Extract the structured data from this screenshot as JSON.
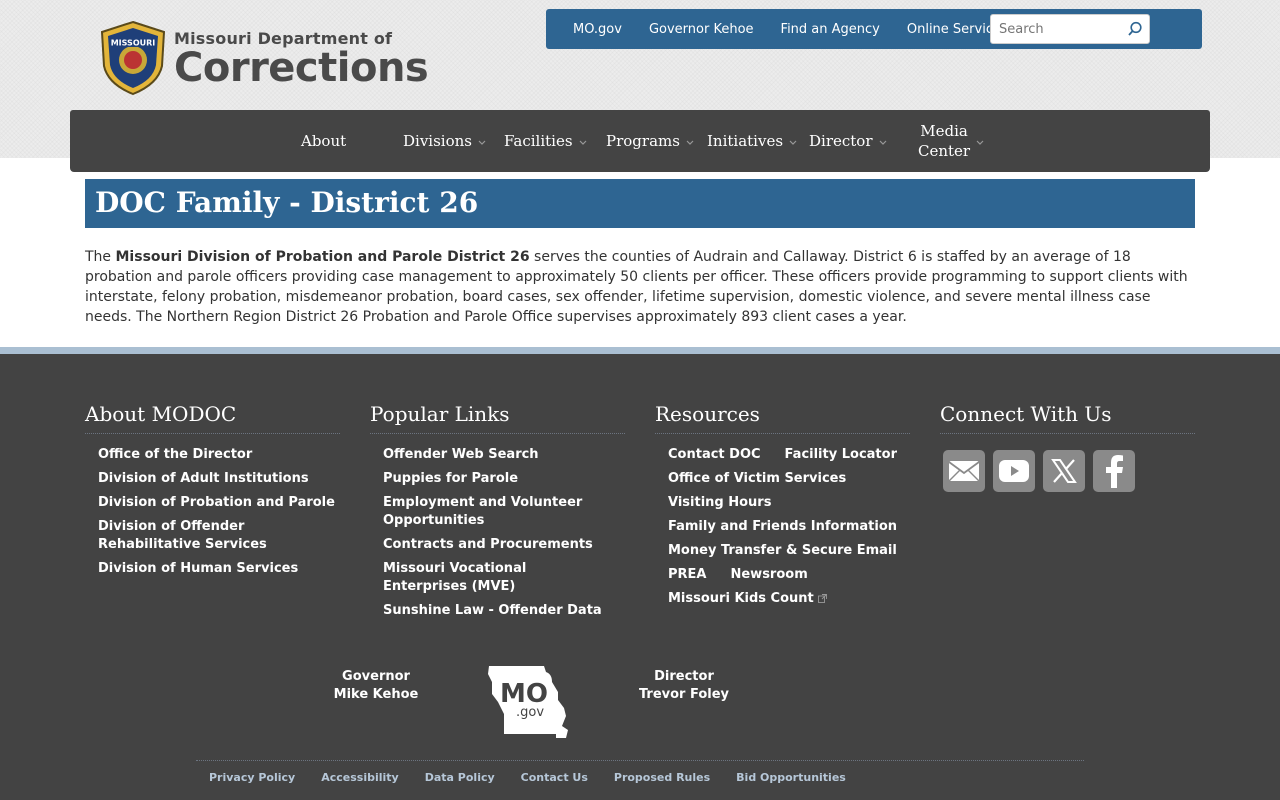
{
  "header": {
    "logo_line1": "Missouri Department of",
    "logo_line2": "Corrections",
    "seal_text": "MISSOURI"
  },
  "utility": {
    "links": [
      "MO.gov",
      "Governor Kehoe",
      "Find an Agency",
      "Online Services"
    ],
    "search_placeholder": "Search"
  },
  "nav": {
    "about": "About",
    "divisions": "Divisions",
    "facilities": "Facilities",
    "programs": "Programs",
    "initiatives": "Initiatives",
    "director": "Director",
    "media_line1": "Media",
    "media_line2": "Center"
  },
  "page": {
    "title": "DOC Family - District 26",
    "intro_pre": "The ",
    "intro_bold": "Missouri Division of Probation and Parole District 26",
    "intro_post": " serves the counties of Audrain and Callaway.   District 6 is staffed by an average of 18 probation and parole officers providing case management to approximately 50 clients per officer.  These officers provide programming to support clients with interstate, felony probation, misdemeanor probation, board cases, sex offender, lifetime supervision, domestic violence, and severe mental illness case needs. The Northern Region District 26 Probation and Parole Office supervises approximately 893 client cases a year."
  },
  "footer": {
    "about": {
      "heading": "About MODOC",
      "links": [
        "Office of the Director",
        "Division of Adult Institutions",
        "Division of Probation and Parole",
        "Division of Offender Rehabilitative Services",
        "Division of Human Services"
      ]
    },
    "popular": {
      "heading": "Popular Links",
      "links": [
        "Offender Web Search",
        "Puppies for Parole",
        "Employment and Volunteer Opportunities",
        "Contracts and Procurements",
        "Missouri Vocational Enterprises (MVE)",
        "Sunshine Law - Offender Data"
      ]
    },
    "resources": {
      "heading": "Resources",
      "contact": "Contact DOC",
      "facility_locator": "Facility Locator",
      "victim": "Office of Victim Services",
      "visiting": "Visiting Hours",
      "family": "Family and Friends Information",
      "money": "Money Transfer & Secure Email",
      "prea": "PREA",
      "newsroom": "Newsroom",
      "kids": "Missouri Kids Count"
    },
    "connect": {
      "heading": "Connect With Us"
    },
    "governor_title": "Governor",
    "governor_name": "Mike Kehoe",
    "director_title": "Director",
    "director_name": "Trevor Foley",
    "mogov_main": "MO",
    "mogov_sub": ".gov",
    "bottom_links": [
      "Privacy Policy",
      "Accessibility",
      "Data Policy",
      "Contact Us",
      "Proposed Rules",
      "Bid Opportunities"
    ]
  },
  "colors": {
    "primary_blue": "#2e6592",
    "nav_dark": "#444444",
    "footer_bg": "#434343"
  }
}
